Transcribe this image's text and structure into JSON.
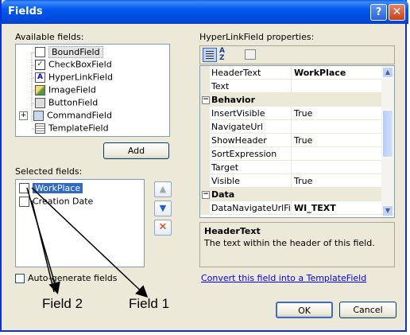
{
  "window": {
    "title": "Fields",
    "help_glyph": "?",
    "close_glyph": "✕"
  },
  "available": {
    "label": "Available fields:",
    "items": [
      {
        "label": "BoundField",
        "icon": "bound-field-icon"
      },
      {
        "label": "CheckBoxField",
        "icon": "checkbox-field-icon"
      },
      {
        "label": "HyperLinkField",
        "icon": "hyperlink-field-icon"
      },
      {
        "label": "ImageField",
        "icon": "image-field-icon"
      },
      {
        "label": "ButtonField",
        "icon": "button-field-icon"
      },
      {
        "label": "CommandField",
        "icon": "command-field-icon"
      },
      {
        "label": "TemplateField",
        "icon": "template-field-icon"
      }
    ],
    "expand_glyph": "+",
    "add_label": "Add"
  },
  "selected": {
    "label": "Selected fields:",
    "items": [
      {
        "label": "WorkPlace",
        "icon": "bound-field-icon"
      },
      {
        "label": "Creation Date",
        "icon": "bound-field-icon"
      }
    ],
    "up_glyph": "▲",
    "down_glyph": "▼",
    "delete_glyph": "✕"
  },
  "auto_generate": {
    "label": "Auto-generate fields",
    "checked": false
  },
  "properties": {
    "label": "HyperLinkField properties:",
    "rows": [
      {
        "kind": "prop",
        "name": "HeaderText",
        "value": "WorkPlace",
        "bold": true
      },
      {
        "kind": "prop",
        "name": "Text",
        "value": ""
      },
      {
        "kind": "cat",
        "name": "Behavior",
        "toggle": "−"
      },
      {
        "kind": "prop",
        "name": "InsertVisible",
        "value": "True"
      },
      {
        "kind": "prop",
        "name": "NavigateUrl",
        "value": ""
      },
      {
        "kind": "prop",
        "name": "ShowHeader",
        "value": "True"
      },
      {
        "kind": "prop",
        "name": "SortExpression",
        "value": ""
      },
      {
        "kind": "prop",
        "name": "Target",
        "value": ""
      },
      {
        "kind": "prop",
        "name": "Visible",
        "value": "True"
      },
      {
        "kind": "cat",
        "name": "Data",
        "toggle": "−"
      },
      {
        "kind": "prop",
        "name": "DataNavigateUrlFiel",
        "value": "WI_TEXT",
        "bold": true
      }
    ],
    "desc_title": "HeaderText",
    "desc_text": "The text within the header of this field.",
    "convert_link": "Convert this field into a TemplateField"
  },
  "buttons": {
    "ok": "OK",
    "cancel": "Cancel"
  },
  "annotations": {
    "field2": "Field 2",
    "field1": "Field 1"
  }
}
